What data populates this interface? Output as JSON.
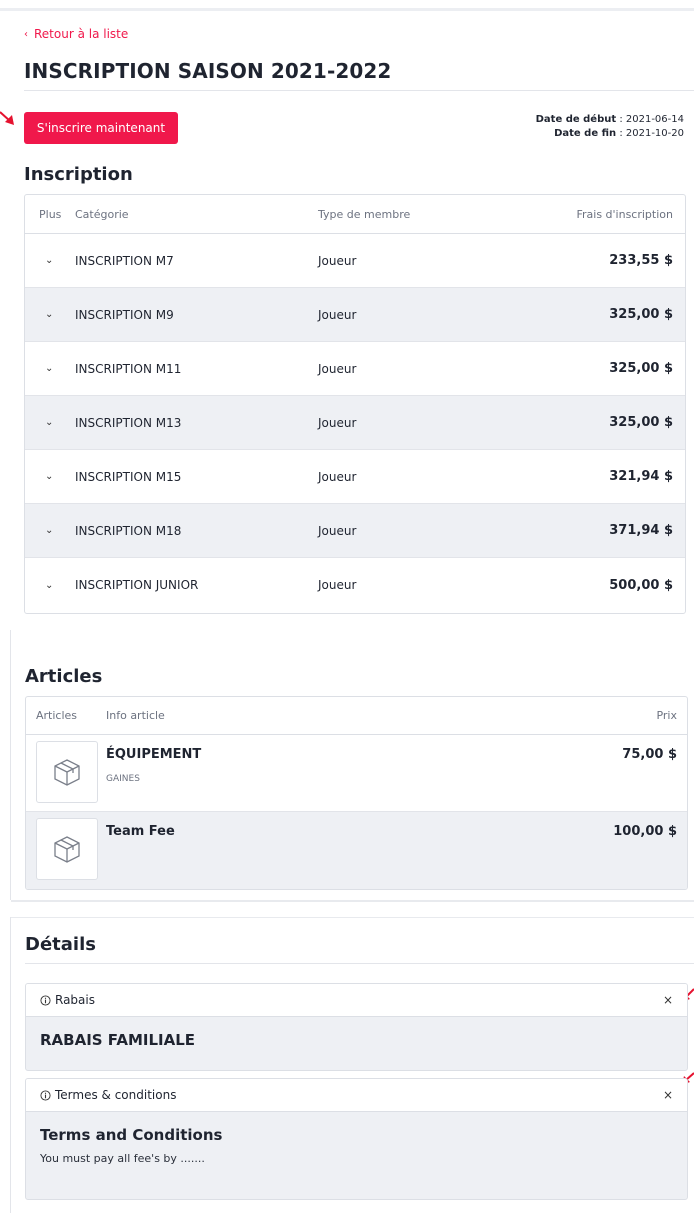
{
  "header": {
    "back_label": "Retour à la liste",
    "title": "INSCRIPTION SAISON 2021-2022",
    "cta_label": "S'inscrire maintenant",
    "start_label": "Date de début",
    "start_value": ": 2021-06-14",
    "end_label": "Date de fin",
    "end_value": ": 2021-10-20"
  },
  "inscription": {
    "heading": "Inscription",
    "columns": [
      "Plus",
      "Catégorie",
      "Type de membre",
      "Frais d'inscription"
    ],
    "rows": [
      {
        "category": "INSCRIPTION M7",
        "type": "Joueur",
        "fee": "233,55 $"
      },
      {
        "category": "INSCRIPTION M9",
        "type": "Joueur",
        "fee": "325,00 $"
      },
      {
        "category": "INSCRIPTION M11",
        "type": "Joueur",
        "fee": "325,00 $"
      },
      {
        "category": "INSCRIPTION M13",
        "type": "Joueur",
        "fee": "325,00 $"
      },
      {
        "category": "INSCRIPTION M15",
        "type": "Joueur",
        "fee": "321,94 $"
      },
      {
        "category": "INSCRIPTION M18",
        "type": "Joueur",
        "fee": "371,94 $"
      },
      {
        "category": "INSCRIPTION JUNIOR",
        "type": "Joueur",
        "fee": "500,00 $"
      }
    ]
  },
  "articles": {
    "heading": "Articles",
    "columns": [
      "Articles",
      "Info article",
      "Prix"
    ],
    "rows": [
      {
        "name": "ÉQUIPEMENT",
        "sub": "GAINES",
        "price": "75,00 $"
      },
      {
        "name": "Team Fee",
        "sub": "",
        "price": "100,00 $"
      }
    ]
  },
  "details": {
    "heading": "Détails",
    "panels": [
      {
        "label": "Rabais",
        "title": "RABAIS FAMILIALE",
        "text": ""
      },
      {
        "label": "Termes & conditions",
        "title": "Terms and Conditions",
        "text": "You must pay all fee's by ......."
      }
    ]
  },
  "icons": {
    "back": "chevron-left-icon",
    "expand": "chevron-down-icon",
    "product": "box-icon",
    "info": "info-icon",
    "close": "close-icon"
  },
  "colors": {
    "accent": "#f0184b",
    "annotation_arrow": "#e5122f",
    "row_alt": "#eef0f4"
  }
}
